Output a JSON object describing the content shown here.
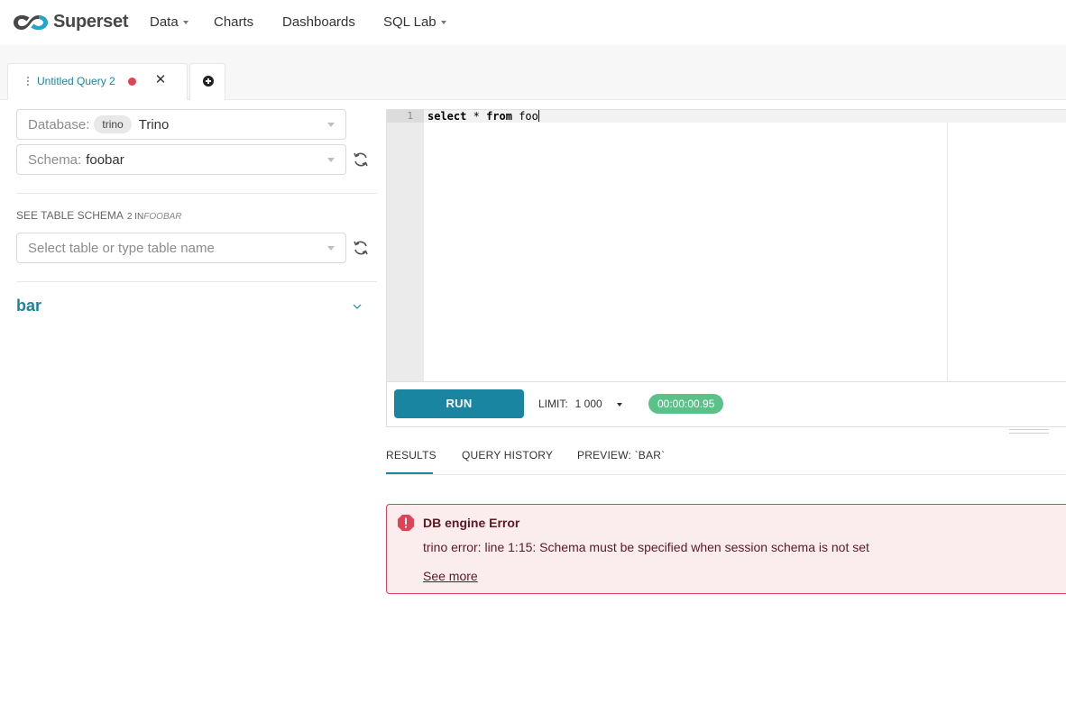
{
  "nav": {
    "logo_text": "Superset",
    "items": [
      {
        "label": "Data",
        "has_caret": true
      },
      {
        "label": "Charts",
        "has_caret": false
      },
      {
        "label": "Dashboards",
        "has_caret": false
      },
      {
        "label": "SQL Lab",
        "has_caret": true
      }
    ]
  },
  "query_tabs": {
    "active_tab": {
      "title": "Untitled Query 2",
      "status_color": "#e04355",
      "close_icon": "close-icon"
    },
    "add_tab_icon": "plus-circle-icon"
  },
  "left_panel": {
    "database": {
      "label": "Database:",
      "tag": "trino",
      "value": "Trino"
    },
    "schema": {
      "label": "Schema:",
      "value": "foobar"
    },
    "table_schema_header": {
      "label": "SEE TABLE SCHEMA",
      "count": "2 IN",
      "schema_name": "FOOBAR"
    },
    "table_select": {
      "placeholder": "Select table or type table name"
    },
    "tables": [
      {
        "name": "bar",
        "collapsed": true
      }
    ]
  },
  "editor": {
    "line_number": "1",
    "sql_keyword_select": "select",
    "sql_star": "*",
    "sql_keyword_from": "from",
    "sql_table": "foo"
  },
  "toolbar": {
    "run_label": "RUN",
    "limit_label": "LIMIT:",
    "limit_value": "1 000",
    "timer": "00:00:00.95",
    "timer_color": "#5ac189"
  },
  "results": {
    "tabs": [
      "RESULTS",
      "QUERY HISTORY",
      "PREVIEW: `BAR`"
    ],
    "active_tab_index": 0,
    "error": {
      "title": "DB engine Error",
      "message": "trino error: line 1:15: Schema must be specified when session schema is not set",
      "link": "See more"
    }
  },
  "colors": {
    "accent": "#1a85a0",
    "error": "#e04355",
    "error_bg": "#fbecee",
    "error_text": "#5c1a22"
  }
}
